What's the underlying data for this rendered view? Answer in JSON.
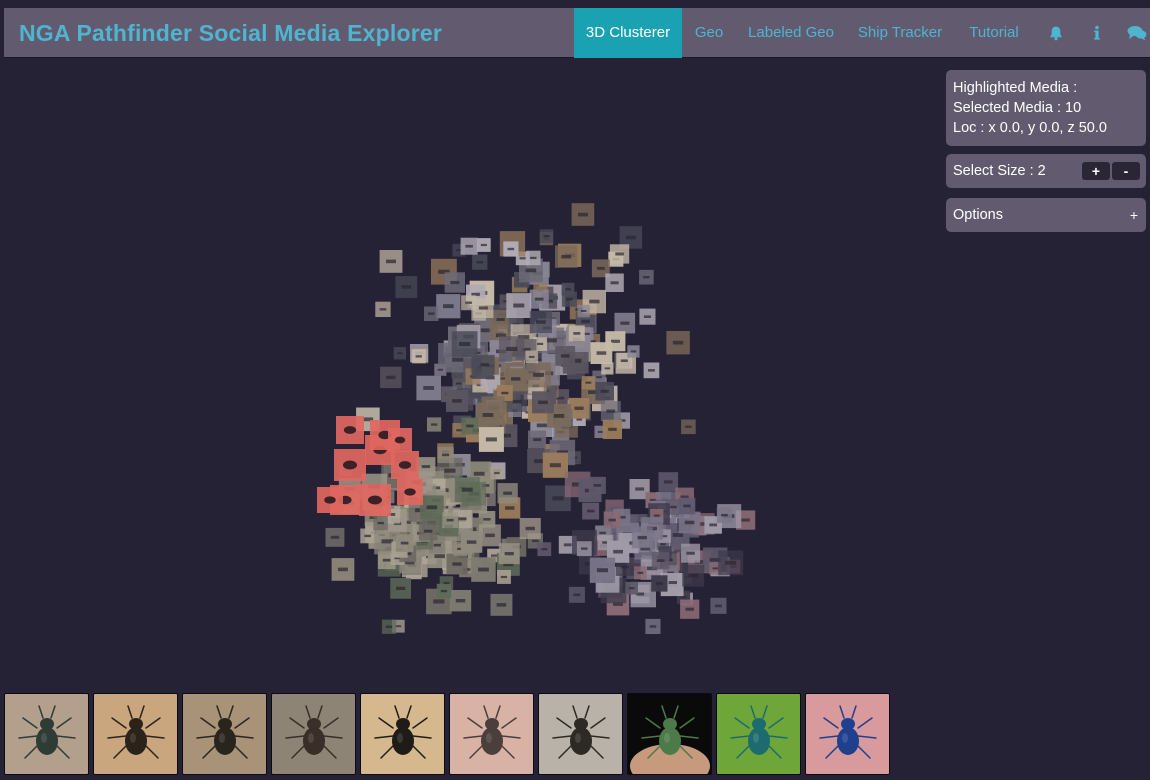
{
  "app": {
    "title": "NGA Pathfinder Social Media Explorer"
  },
  "nav": {
    "items": [
      {
        "label": "3D Clusterer",
        "active": true
      },
      {
        "label": "Geo",
        "active": false
      },
      {
        "label": "Labeled Geo",
        "active": false
      },
      {
        "label": "Ship Tracker",
        "active": false
      },
      {
        "label": "Tutorial",
        "active": false
      }
    ],
    "icons": [
      "bell-icon",
      "info-icon",
      "chat-icon"
    ]
  },
  "info_panel": {
    "highlighted": "Highlighted Media :",
    "selected": "Selected Media : 10",
    "loc": "Loc : x 0.0, y 0.0, z 50.0"
  },
  "size_panel": {
    "label": "Select Size : 2",
    "plus": "+",
    "minus": "-"
  },
  "options_panel": {
    "label": "Options",
    "toggle": "+"
  },
  "colors": {
    "background": "#252236",
    "navbar": "#625b6f",
    "brand": "#4fb4d0",
    "active_tab": "#1aa2b3",
    "selection_highlight": "#e0675f"
  },
  "thumbnails": [
    {
      "bg": "#b3a08c",
      "body": "#2f3b35"
    },
    {
      "bg": "#c9a67e",
      "body": "#2b2219"
    },
    {
      "bg": "#a89379",
      "body": "#2a241e"
    },
    {
      "bg": "#8e8476",
      "body": "#3a2e28"
    },
    {
      "bg": "#d6b88e",
      "body": "#1f1c18"
    },
    {
      "bg": "#d8b2a4",
      "body": "#4a3f3a"
    },
    {
      "bg": "#b8b2a8",
      "body": "#2d2a26"
    },
    {
      "bg": "#0a0a0a",
      "body": "#4c7a48",
      "spot": "#c79a7e"
    },
    {
      "bg": "#6fa63a",
      "body": "#1d6b6e"
    },
    {
      "bg": "#d99a9e",
      "body": "#1f3f8f"
    }
  ]
}
